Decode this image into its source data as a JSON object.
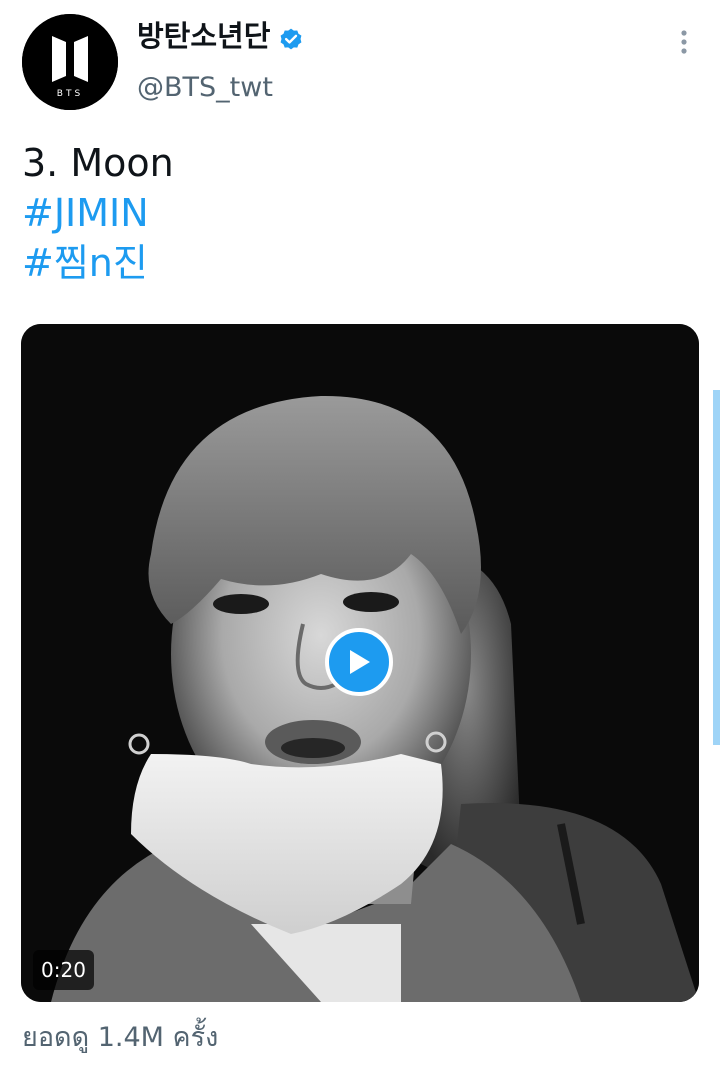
{
  "author": {
    "display_name": "방탄소년단",
    "handle": "@BTS_twt",
    "avatar_label": "BTS",
    "verified": true
  },
  "tweet": {
    "lines": [
      {
        "text": "3. Moon",
        "type": "text"
      },
      {
        "text": "#JIMIN",
        "type": "hashtag"
      },
      {
        "text": "#찜n진",
        "type": "hashtag"
      }
    ]
  },
  "media": {
    "type": "video",
    "duration": "0:20"
  },
  "views": {
    "prefix": "ยอดดู",
    "count": "1.4M",
    "suffix": "ครั้ง"
  },
  "colors": {
    "link": "#1d9bf0",
    "secondary_text": "#536471",
    "primary_text": "#0f1419"
  },
  "icons": {
    "verified": "verified-badge-icon",
    "more": "more-vertical-icon",
    "play": "play-icon"
  }
}
